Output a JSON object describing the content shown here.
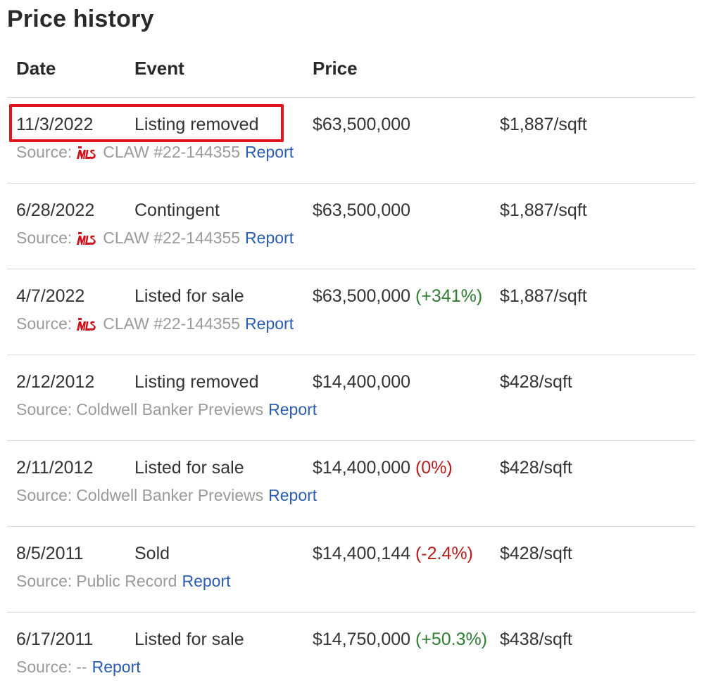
{
  "page": {
    "title": "Price history"
  },
  "table": {
    "headers": {
      "date": "Date",
      "event": "Event",
      "price": "Price",
      "sqft": ""
    },
    "rows": [
      {
        "date": "11/3/2022",
        "event": "Listing removed",
        "price": "$63,500,000",
        "change": "",
        "change_dir": "",
        "sqft": "$1,887/sqft",
        "source_prefix": "Source:",
        "source_icon": "mls-icon",
        "source": "CLAW #22-144355",
        "report": "Report",
        "highlighted": true
      },
      {
        "date": "6/28/2022",
        "event": "Contingent",
        "price": "$63,500,000",
        "change": "",
        "change_dir": "",
        "sqft": "$1,887/sqft",
        "source_prefix": "Source:",
        "source_icon": "mls-icon",
        "source": "CLAW #22-144355",
        "report": "Report"
      },
      {
        "date": "4/7/2022",
        "event": "Listed for sale",
        "price": "$63,500,000",
        "change": "(+341%)",
        "change_dir": "up",
        "sqft": "$1,887/sqft",
        "source_prefix": "Source:",
        "source_icon": "mls-icon",
        "source": "CLAW #22-144355",
        "report": "Report"
      },
      {
        "date": "2/12/2012",
        "event": "Listing removed",
        "price": "$14,400,000",
        "change": "",
        "change_dir": "",
        "sqft": "$428/sqft",
        "source_prefix": "Source:",
        "source_icon": "",
        "source": "Coldwell Banker Previews",
        "report": "Report"
      },
      {
        "date": "2/11/2012",
        "event": "Listed for sale",
        "price": "$14,400,000",
        "change": "(0%)",
        "change_dir": "zero",
        "sqft": "$428/sqft",
        "source_prefix": "Source:",
        "source_icon": "",
        "source": "Coldwell Banker Previews",
        "report": "Report"
      },
      {
        "date": "8/5/2011",
        "event": "Sold",
        "price": "$14,400,144",
        "change": "(-2.4%)",
        "change_dir": "down",
        "sqft": "$428/sqft",
        "source_prefix": "Source:",
        "source_icon": "",
        "source": "Public Record",
        "report": "Report"
      },
      {
        "date": "6/17/2011",
        "event": "Listed for sale",
        "price": "$14,750,000",
        "change": "(+50.3%)",
        "change_dir": "up",
        "sqft": "$438/sqft",
        "source_prefix": "Source:",
        "source_icon": "",
        "source": "--",
        "report": "Report"
      }
    ]
  },
  "colors": {
    "text": "#333333",
    "muted": "#9a9a9a",
    "link": "#2a5db0",
    "increase": "#2e7d32",
    "decrease": "#b71c1c",
    "highlight": "#e0141e",
    "divider": "#d9d9d9",
    "mls_icon": "#d0101a"
  }
}
